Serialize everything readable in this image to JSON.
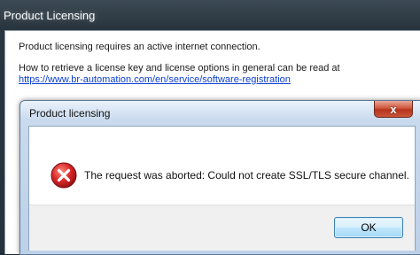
{
  "outer_window": {
    "title": "Product Licensing",
    "line1": "Product licensing requires an active internet connection.",
    "line2": "How to retrieve a license key and license options in general can be read at",
    "link": "https://www.br-automation.com/en/service/software-registration"
  },
  "dialog": {
    "title": "Product licensing",
    "close_label": "x",
    "icon": "error-icon",
    "message": "The request was aborted: Could not create SSL/TLS secure channel.",
    "ok_label": "OK"
  },
  "colors": {
    "error_red": "#c8202a",
    "link_blue": "#0b3ecf",
    "close_red": "#c9553a"
  }
}
